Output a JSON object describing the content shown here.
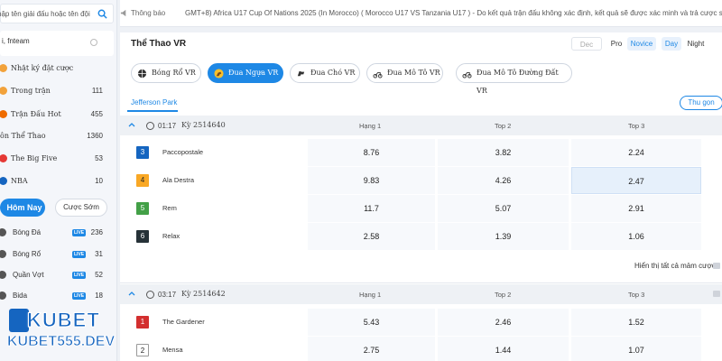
{
  "sidebar": {
    "search_placeholder": "hập tên giải đấu hoặc tên đội",
    "user": "i, fnteam",
    "items": [
      {
        "label": "Nhật ký đặt cược",
        "count": ""
      },
      {
        "label": "Trong trận",
        "count": "111"
      },
      {
        "label": "Trận Đấu Hot",
        "count": "455"
      },
      {
        "label": "ôn Thể Thao",
        "count": "1360"
      },
      {
        "label": "The Big Five",
        "count": "53"
      },
      {
        "label": "NBA",
        "count": "10"
      }
    ],
    "tab_today": "Hôm Nay",
    "tab_early": "Cược Sớm",
    "sports": [
      {
        "label": "Bóng Đá",
        "live": "LIVE",
        "count": "236"
      },
      {
        "label": "Bóng Rổ",
        "live": "LIVE",
        "count": "31"
      },
      {
        "label": "Quần Vợt",
        "live": "LIVE",
        "count": "52"
      },
      {
        "label": "Bida",
        "live": "LIVE",
        "count": "18"
      }
    ],
    "logo_text": "KUBET",
    "logo_domain": "KUBET555.DEV"
  },
  "topbar": {
    "notice_label": "Thông báo",
    "message": "GMT+8) Africa U17 Cup Of Nations 2025 (In Morocco)  ( Morocco U17 VS Tanzania U17 )  - Do kết quả trận đấu không xác định, kết quả sẽ được xác minh và trả cược sau"
  },
  "main": {
    "title": "Thể Thao VR",
    "odds_format": "Dec",
    "level_options": [
      "Pro",
      "Novice"
    ],
    "theme_options": [
      "Day",
      "Night"
    ],
    "categories": [
      "Bóng Rổ VR",
      "Đua Ngựa VR",
      "Đua Chó VR",
      "Đua Mô Tô VR",
      "Đua Mô Tô Đường Đất VR"
    ],
    "track": "Jefferson Park",
    "collapse_label": "Thu gọn",
    "show_all": "Hiển thị tất cả mảm cược",
    "races": [
      {
        "time": "01:17",
        "ky": "Kỳ 2514640",
        "columns": [
          "Hạng 1",
          "Top 2",
          "Top 3"
        ],
        "runners": [
          {
            "num": "3",
            "color": "#1565c0",
            "name": "Paccopostale",
            "odds": [
              "8.76",
              "3.82",
              "2.24"
            ]
          },
          {
            "num": "4",
            "color": "#f9a825",
            "name": "Ala Destra",
            "odds": [
              "9.83",
              "4.26",
              "2.47"
            ]
          },
          {
            "num": "5",
            "color": "#43a047",
            "name": "Rem",
            "odds": [
              "11.7",
              "5.07",
              "2.91"
            ]
          },
          {
            "num": "6",
            "color": "#263238",
            "name": "Relax",
            "odds": [
              "2.58",
              "1.39",
              "1.06"
            ]
          }
        ]
      },
      {
        "time": "03:17",
        "ky": "Kỳ 2514642",
        "columns": [
          "Hạng 1",
          "Top 2",
          "Top 3"
        ],
        "runners": [
          {
            "num": "1",
            "color": "#d32f2f",
            "name": "The Gardener",
            "odds": [
              "5.43",
              "2.46",
              "1.52"
            ]
          },
          {
            "num": "2",
            "color": "#ffffff",
            "name": "Mensa",
            "odds": [
              "2.75",
              "1.44",
              "1.07"
            ]
          }
        ]
      }
    ]
  }
}
